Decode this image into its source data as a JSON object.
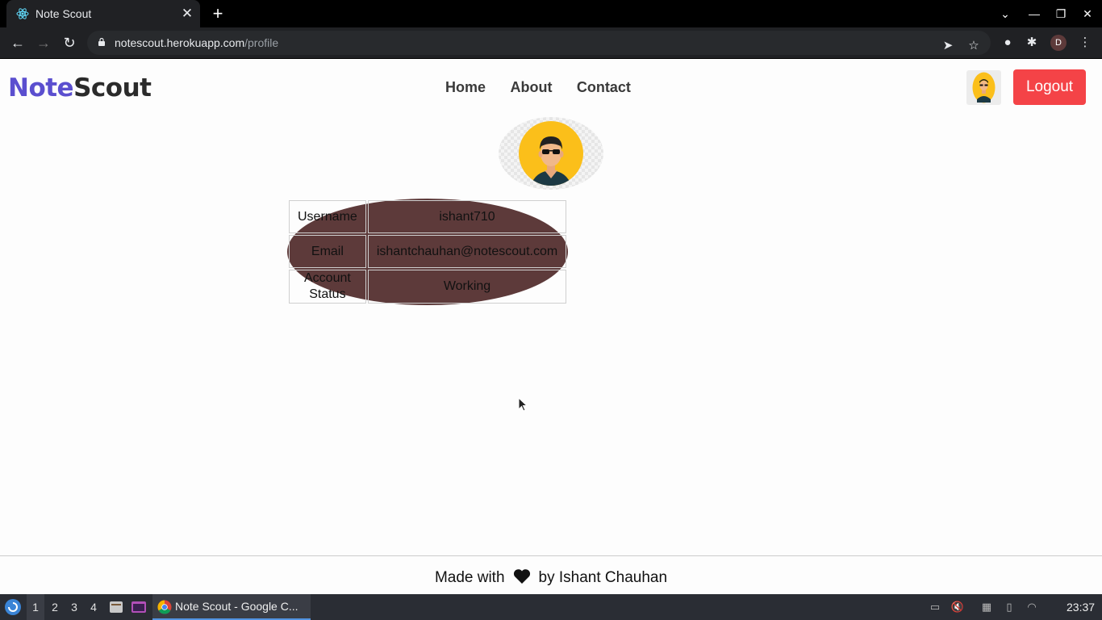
{
  "browser": {
    "tab_title": "Note Scout",
    "url_host": "notescout.herokuapp.com",
    "url_path": "/profile",
    "profile_initial": "D"
  },
  "app": {
    "brand_part1": "Note",
    "brand_part2": "Scout",
    "nav": [
      {
        "label": "Home"
      },
      {
        "label": "About"
      },
      {
        "label": "Contact"
      }
    ],
    "logout_label": "Logout"
  },
  "profile": {
    "rows": [
      {
        "key": "Username",
        "value": "ishant710"
      },
      {
        "key": "Email",
        "value": "ishantchauhan@notescout.com"
      },
      {
        "key": "Account Status",
        "value": "Working"
      }
    ]
  },
  "footer": {
    "made_with": "Made with",
    "by": "by Ishant Chauhan"
  },
  "taskbar": {
    "workspaces": [
      "1",
      "2",
      "3",
      "4"
    ],
    "task_title": "Note Scout - Google C...",
    "clock": "23:37"
  },
  "colors": {
    "brand_accent": "#5b4fcf",
    "logout": "#f44347",
    "avatar_yellow": "#fbbf1a"
  }
}
